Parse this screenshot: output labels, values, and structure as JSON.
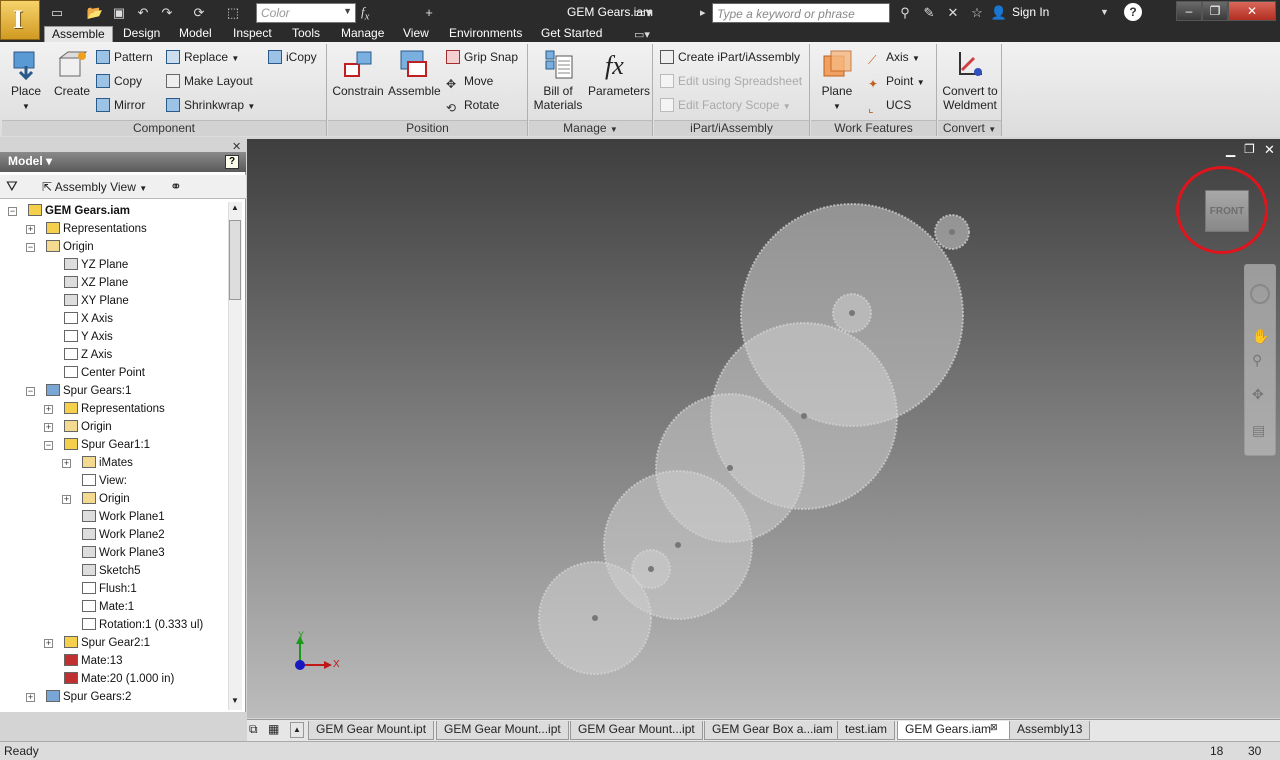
{
  "app": {
    "title": "GEM Gears.iam",
    "search_placeholder": "Type a keyword or phrase",
    "sign_in": "Sign In",
    "color_placeholder": "Color",
    "help": "?"
  },
  "menu_tabs": [
    "Assemble",
    "Design",
    "Model",
    "Inspect",
    "Tools",
    "Manage",
    "View",
    "Environments",
    "Get Started"
  ],
  "ribbon": {
    "component": {
      "title": "Component",
      "place": "Place",
      "create": "Create",
      "pattern": "Pattern",
      "copy": "Copy",
      "mirror": "Mirror",
      "replace": "Replace",
      "make_layout": "Make Layout",
      "shrinkwrap": "Shrinkwrap",
      "icopy": "iCopy"
    },
    "position": {
      "title": "Position",
      "constrain": "Constrain",
      "assemble": "Assemble",
      "grip_snap": "Grip Snap",
      "move": "Move",
      "rotate": "Rotate"
    },
    "manage": {
      "title": "Manage",
      "bom_1": "Bill of",
      "bom_2": "Materials",
      "parameters": "Parameters"
    },
    "ipart": {
      "title": "iPart/iAssembly",
      "create": "Create iPart/iAssembly",
      "edit_spreadsheet": "Edit using Spreadsheet",
      "edit_factory": "Edit Factory Scope"
    },
    "work_features": {
      "title": "Work Features",
      "plane": "Plane",
      "axis": "Axis",
      "point": "Point",
      "ucs": "UCS"
    },
    "convert": {
      "title": "Convert",
      "weldment_1": "Convert to",
      "weldment_2": "Weldment"
    }
  },
  "browser": {
    "title": "Model",
    "view_mode": "Assembly View",
    "tree": [
      {
        "label": "GEM Gears.iam",
        "bold": true
      },
      {
        "label": "Representations"
      },
      {
        "label": "Origin"
      },
      {
        "label": "YZ Plane"
      },
      {
        "label": "XZ Plane"
      },
      {
        "label": "XY Plane"
      },
      {
        "label": "X Axis"
      },
      {
        "label": "Y Axis"
      },
      {
        "label": "Z Axis"
      },
      {
        "label": "Center Point"
      },
      {
        "label": "Spur Gears:1"
      },
      {
        "label": "Representations"
      },
      {
        "label": "Origin"
      },
      {
        "label": "Spur Gear1:1"
      },
      {
        "label": "iMates"
      },
      {
        "label": "View:"
      },
      {
        "label": "Origin"
      },
      {
        "label": "Work Plane1"
      },
      {
        "label": "Work Plane2"
      },
      {
        "label": "Work Plane3"
      },
      {
        "label": "Sketch5"
      },
      {
        "label": "Flush:1"
      },
      {
        "label": "Mate:1"
      },
      {
        "label": "Rotation:1 (0.333 ul)"
      },
      {
        "label": "Spur Gear2:1"
      },
      {
        "label": "Mate:13"
      },
      {
        "label": "Mate:20 (1.000 in)"
      },
      {
        "label": "Spur Gears:2"
      }
    ]
  },
  "viewport": {
    "viewcube_face": "FRONT",
    "axis_x": "X",
    "axis_y": "Y"
  },
  "doc_tabs": [
    "GEM Gear Mount.ipt",
    "GEM Gear Mount...ipt",
    "GEM Gear Mount...ipt",
    "GEM Gear Box a...iam",
    "test.iam",
    "GEM Gears.iam",
    "Assembly13"
  ],
  "status": {
    "text": "Ready",
    "num1": "18",
    "num2": "30"
  },
  "colors": {
    "highlight_circle": "#e0141c",
    "app_button": "#e8b440"
  }
}
